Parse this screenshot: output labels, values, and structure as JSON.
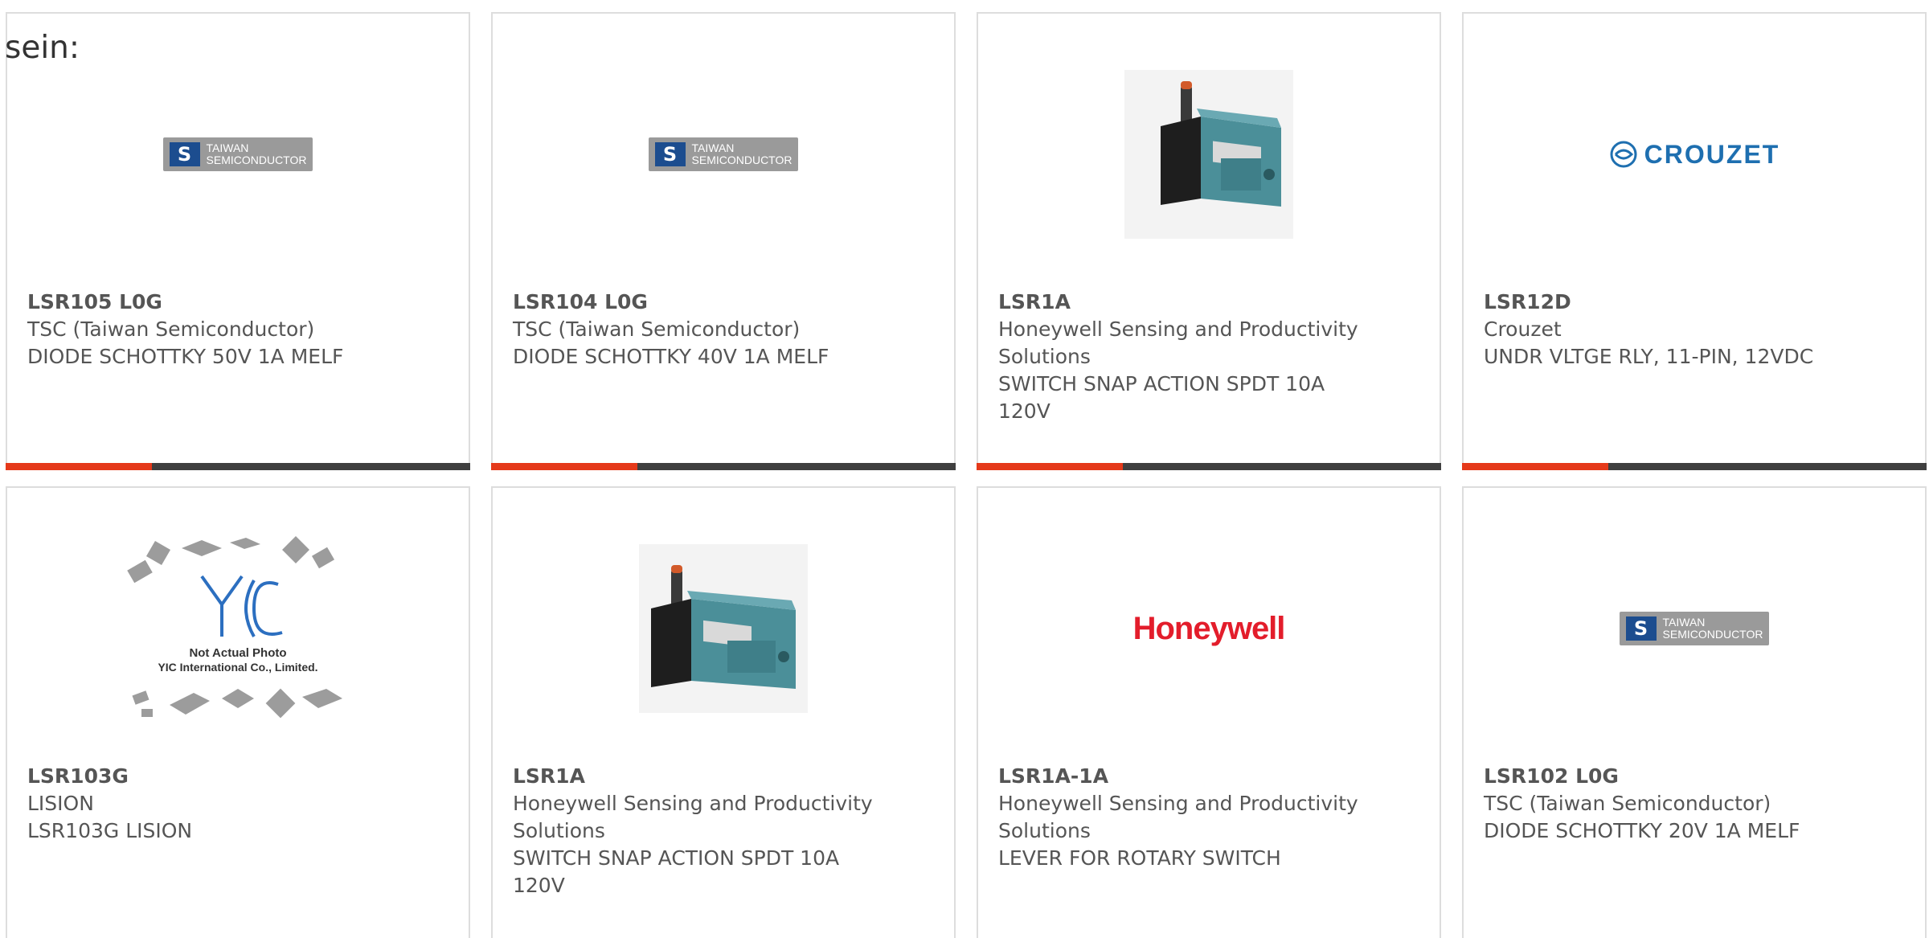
{
  "intro_text": "sein:",
  "colors": {
    "accent": "#e5391a",
    "bar": "#3f3f3f",
    "border": "#dddddd",
    "text": "#555555",
    "tsc_blue": "#1c4d8f",
    "crouzet_blue": "#1e6fb0",
    "honeywell_red": "#e31d2b"
  },
  "logos": {
    "tsc_mark": "S",
    "tsc_line1": "TAIWAN",
    "tsc_line2": "SEMICONDUCTOR",
    "crouzet": "CROUZET",
    "honeywell": "Honeywell",
    "yic_caption1": "Not Actual Photo",
    "yic_caption2": "YIC International Co., Limited."
  },
  "products": [
    {
      "part": "LSR105 L0G",
      "manufacturer": "TSC (Taiwan Semiconductor)",
      "description": "DIODE SCHOTTKY 50V 1A MELF",
      "image": "tsc-logo"
    },
    {
      "part": "LSR104 L0G",
      "manufacturer": "TSC (Taiwan Semiconductor)",
      "description": "DIODE SCHOTTKY 40V 1A MELF",
      "image": "tsc-logo"
    },
    {
      "part": "LSR1A",
      "manufacturer": "Honeywell Sensing and Productivity Solutions",
      "description": "SWITCH SNAP ACTION SPDT 10A 120V",
      "image": "limit-switch-photo"
    },
    {
      "part": "LSR12D",
      "manufacturer": "Crouzet",
      "description": "UNDR VLTGE RLY, 11-PIN, 12VDC",
      "image": "crouzet-logo"
    },
    {
      "part": "LSR103G",
      "manufacturer": "LISION",
      "description": "LSR103G LISION",
      "image": "yic-placeholder"
    },
    {
      "part": "LSR1A",
      "manufacturer": "Honeywell Sensing and Productivity Solutions",
      "description": "SWITCH SNAP ACTION SPDT 10A 120V",
      "image": "limit-switch-photo"
    },
    {
      "part": "LSR1A-1A",
      "manufacturer": "Honeywell Sensing and Productivity Solutions",
      "description": "LEVER FOR ROTARY SWITCH",
      "image": "honeywell-logo"
    },
    {
      "part": "LSR102 L0G",
      "manufacturer": "TSC (Taiwan Semiconductor)",
      "description": "DIODE SCHOTTKY 20V 1A MELF",
      "image": "tsc-logo"
    }
  ]
}
